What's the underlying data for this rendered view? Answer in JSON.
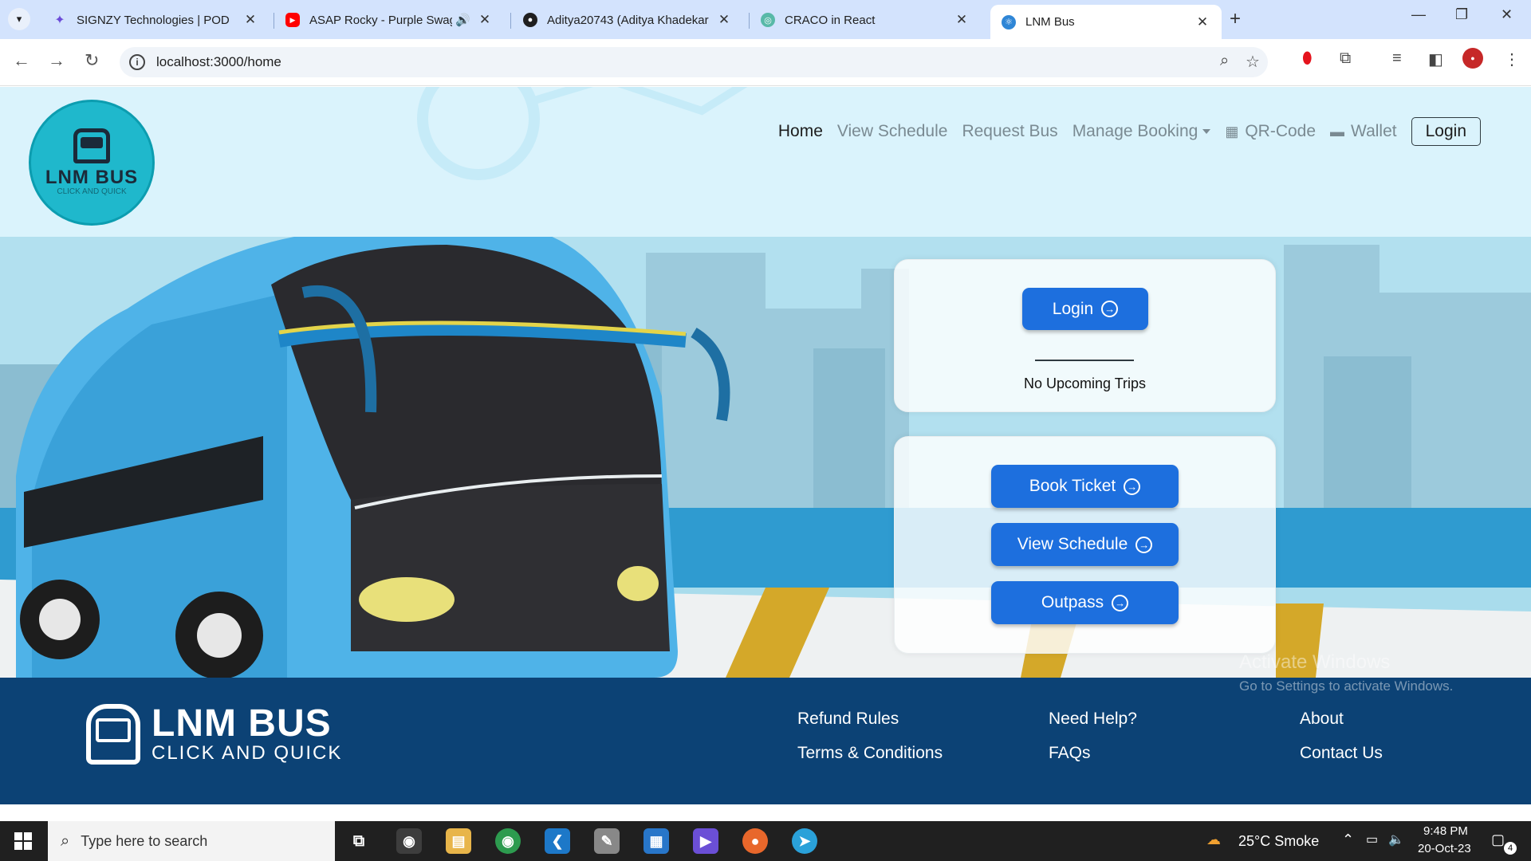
{
  "browser": {
    "tabs": [
      {
        "title": "SIGNZY Technologies | POD",
        "icon": "signzy-icon",
        "color": "#6c4cd8"
      },
      {
        "title": "ASAP Rocky - Purple Swag",
        "icon": "youtube-icon",
        "color": "#ff0000",
        "audio": true
      },
      {
        "title": "Aditya20743 (Aditya Khadekar",
        "icon": "github-icon",
        "color": "#1f1f1f"
      },
      {
        "title": "CRACO in React",
        "icon": "craco-icon",
        "color": "#58b9a8"
      },
      {
        "title": "LNM Bus",
        "icon": "react-icon",
        "color": "#2f86d6",
        "active": true
      }
    ],
    "url": "localhost:3000/home"
  },
  "header": {
    "logo_title": "LNM BUS",
    "logo_subtitle": "CLICK AND QUICK",
    "nav": {
      "home": "Home",
      "view_schedule": "View Schedule",
      "request_bus": "Request Bus",
      "manage_booking": "Manage Booking",
      "qr_code": "QR-Code",
      "wallet": "Wallet",
      "login": "Login"
    }
  },
  "hero": {
    "login_button": "Login",
    "trips_text": "No Upcoming Trips",
    "actions": {
      "book_ticket": "Book Ticket",
      "view_schedule": "View Schedule",
      "outpass": "Outpass"
    }
  },
  "footer": {
    "logo_title": "LNM BUS",
    "logo_subtitle": "CLICK AND QUICK",
    "links": {
      "refund_rules": "Refund Rules",
      "terms": "Terms & Conditions",
      "need_help": "Need Help?",
      "faqs": "FAQs",
      "about": "About",
      "contact": "Contact Us"
    },
    "watermark_title": "Activate Windows",
    "watermark_sub": "Go to Settings to activate Windows."
  },
  "taskbar": {
    "search_placeholder": "Type here to search",
    "weather": "25°C  Smoke",
    "time": "9:48 PM",
    "date": "20-Oct-23",
    "notifications": "4"
  },
  "colors": {
    "primary_button": "#1d6fde",
    "footer_bg": "#0c4275",
    "header_bg": "#daf3fc"
  }
}
